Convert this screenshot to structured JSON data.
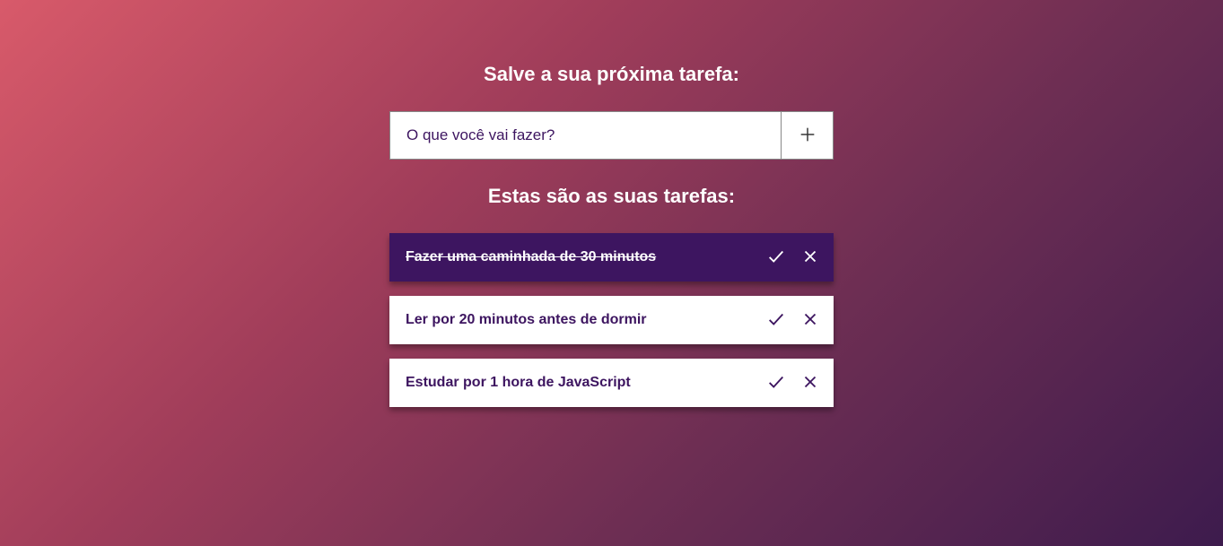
{
  "header": {
    "input_heading": "Salve a sua próxima tarefa:",
    "list_heading": "Estas são as suas tarefas:"
  },
  "input": {
    "placeholder": "O que você vai fazer?",
    "value": ""
  },
  "tasks": [
    {
      "text": "Fazer uma caminhada de 30 minutos",
      "done": true
    },
    {
      "text": "Ler por 20 minutos antes de dormir",
      "done": false
    },
    {
      "text": "Estudar por 1 hora de JavaScript",
      "done": false
    }
  ]
}
